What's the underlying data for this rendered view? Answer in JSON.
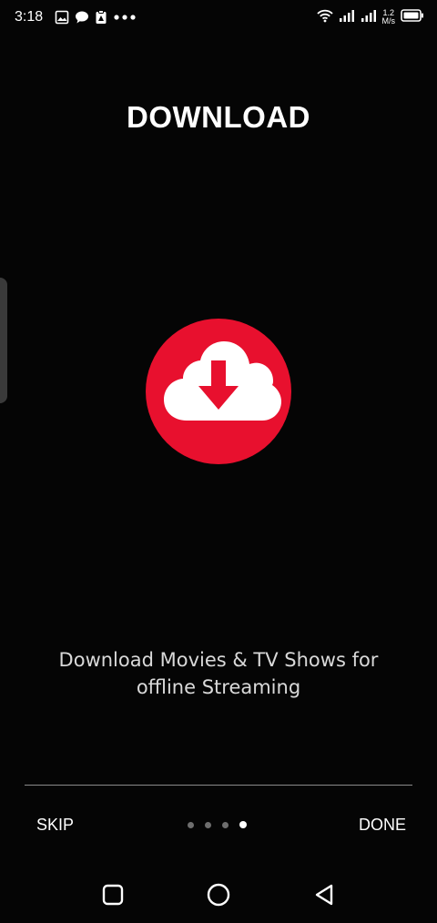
{
  "status_bar": {
    "time": "3:18",
    "net_speed_value": "1.2",
    "net_speed_unit": "M/s",
    "icons_left": [
      "image-icon",
      "chat-bubble-icon",
      "clipboard-icon",
      "more-dots-icon"
    ],
    "icons_right": [
      "wifi-icon",
      "signal-icon",
      "signal-icon",
      "battery-icon"
    ]
  },
  "page": {
    "title": "DOWNLOAD",
    "description_line1": "Download Movies & TV Shows for",
    "description_line2": "offline Streaming",
    "illustration_icon": "cloud-download-icon"
  },
  "onboarding": {
    "skip_label": "SKIP",
    "done_label": "DONE",
    "total_pages": 4,
    "current_page": 4
  },
  "nav_bar": {
    "buttons": [
      "recents-button",
      "home-button",
      "back-button"
    ]
  },
  "colors": {
    "background": "#050505",
    "accent": "#e8102e",
    "text": "#ffffff"
  }
}
